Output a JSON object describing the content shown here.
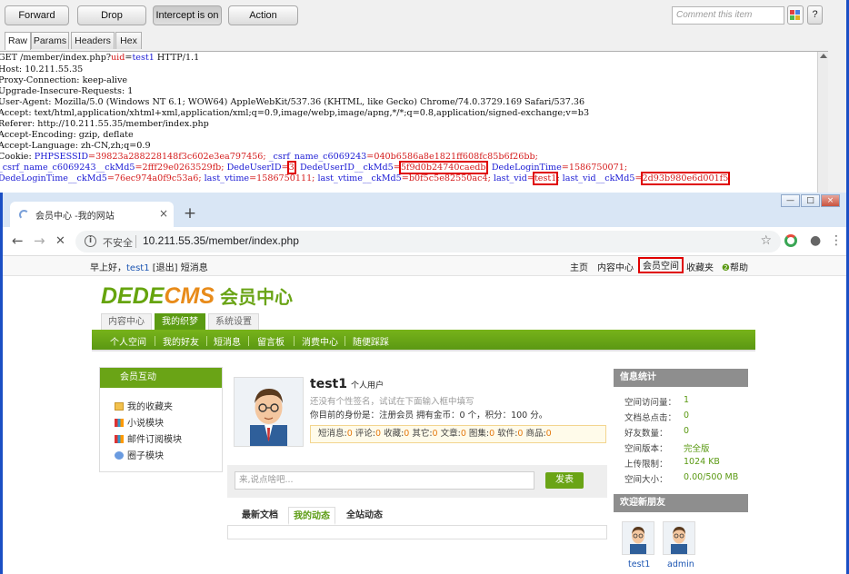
{
  "burp": {
    "buttons": {
      "forward": "Forward",
      "drop": "Drop",
      "intercept": "Intercept is on",
      "action": "Action"
    },
    "comment_placeholder": "Comment this item",
    "help": "?",
    "tabs": [
      "Raw",
      "Params",
      "Headers",
      "Hex"
    ],
    "request": {
      "line1a": "GET /member/index.php?",
      "line1b": "uid",
      "line1c": "=",
      "line1d": "test1",
      "line1e": " HTTP/1.1",
      "host": "Host: 10.211.55.35",
      "proxy": "Proxy-Connection: keep-alive",
      "upgrade": "Upgrade-Insecure-Requests: 1",
      "ua": "User-Agent: Mozilla/5.0 (Windows NT 6.1; WOW64) AppleWebKit/537.36 (KHTML, like Gecko) Chrome/74.0.3729.169 Safari/537.36",
      "accept": "Accept: text/html,application/xhtml+xml,application/xml;q=0.9,image/webp,image/apng,*/*;q=0.8,application/signed-exchange;v=b3",
      "referer": "Referer: http://10.211.55.35/member/index.php",
      "encoding": "Accept-Encoding: gzip, deflate",
      "language": "Accept-Language: zh-CN,zh;q=0.9",
      "cookie1": {
        "k": "Cookie: ",
        "n1": "PHPSESSID",
        "v1": "=39823a288228148f3c602e3ea797456; ",
        "n2": "_csrf_name_c6069243",
        "v2": "=040b6586a8e1821ff608fc85b6f26bb;"
      },
      "cookie2": {
        "n1": "_csrf_name_c6069243__ckMd5",
        "v1": "=2fff29e0263529fb; ",
        "n2": "DedeUserID",
        "eq": "=",
        "v2": "3",
        "sep": "; ",
        "n3": "DedeUserID__ckMd5",
        "eq3": "=",
        "v3": "5f9d0b24740caedb",
        "sep3": "; ",
        "n4": "DedeLoginTime",
        "v4": "=1586750071;"
      },
      "cookie3": {
        "n1": "DedeLoginTime__ckMd5",
        "v1": "=76ec974a0f9c53a6; ",
        "n2": "last_vtime",
        "v2": "=1586750111; ",
        "n3": "last_vtime__ckMd5",
        "v3": "=b0f5c5e82550ac4; ",
        "n4": "last_vid",
        "eq4": "=",
        "v4": "test1",
        "sep4": "; ",
        "n5": "last_vid__ckMd5",
        "eq5": "=",
        "v5": "2d93b980e6d001f5"
      }
    }
  },
  "browser": {
    "tab_title": "会员中心 -我的网站",
    "tab_close": "×",
    "new_tab": "+",
    "window": {
      "min": "—",
      "max": "□",
      "close": "×"
    },
    "insecure": "不安全",
    "url": "10.211.55.35/member/index.php",
    "info_icon": "i",
    "icons": {
      "back": "←",
      "forward": "→",
      "reload": "✕",
      "star": "☆",
      "profile": "●",
      "menu": "⋮"
    }
  },
  "site": {
    "greeting": "早上好，",
    "username": "test1",
    "logout": "[退出]",
    "messages": "短消息",
    "top_links": [
      "主页",
      "内容中心",
      "会员空间",
      "收藏夹",
      "帮助"
    ],
    "logo_a": "DEDE",
    "logo_b": "CMS",
    "logo_c": "会员中心",
    "page_tabs": [
      "内容中心",
      "我的织梦",
      "系统设置"
    ],
    "menu": [
      "个人空间",
      "我的好友",
      "短消息",
      "留言板",
      "消费中心",
      "随便踩踩"
    ],
    "left": {
      "header": "会员互动",
      "items": [
        "我的收藏夹",
        "小说模块",
        "邮件订阅模块",
        "圈子模块"
      ]
    },
    "profile": {
      "name": "test1",
      "role": "个人用户",
      "signature": "还没有个性签名，试试在下面输入框中填写",
      "identity": "你目前的身份是：注册会员 拥有金币：0 个，积分：100 分。",
      "stats": [
        {
          "label": "短消息:",
          "value": "0"
        },
        {
          "label": "评论:",
          "value": "0"
        },
        {
          "label": "收藏:",
          "value": "0"
        },
        {
          "label": "其它:",
          "value": "0"
        },
        {
          "label": "文章:",
          "value": "0"
        },
        {
          "label": "图集:",
          "value": "0"
        },
        {
          "label": "软件:",
          "value": "0"
        },
        {
          "label": "商品:",
          "value": "0"
        }
      ]
    },
    "post": {
      "placeholder": "来,说点啥吧...",
      "button": "发表"
    },
    "content_tabs": [
      "最新文档",
      "我的动态",
      "全站动态"
    ],
    "info": {
      "header": "信息统计",
      "rows": [
        {
          "label": "空间访问量：",
          "value": "1"
        },
        {
          "label": "文档总点击：",
          "value": "0"
        },
        {
          "label": "好友数量：",
          "value": "0"
        },
        {
          "label": "空间版本：",
          "value": "完全版"
        },
        {
          "label": "上传限制：",
          "value": "1024 KB"
        },
        {
          "label": "空间大小：",
          "value": "0.00/500 MB"
        }
      ]
    },
    "friends": {
      "header": "欢迎新朋友",
      "names": [
        "test1",
        "admin"
      ]
    }
  },
  "colors": {
    "accent_green": "#6aa416",
    "highlight_red": "#e00000",
    "burp_blue": "#1b4fc4"
  }
}
